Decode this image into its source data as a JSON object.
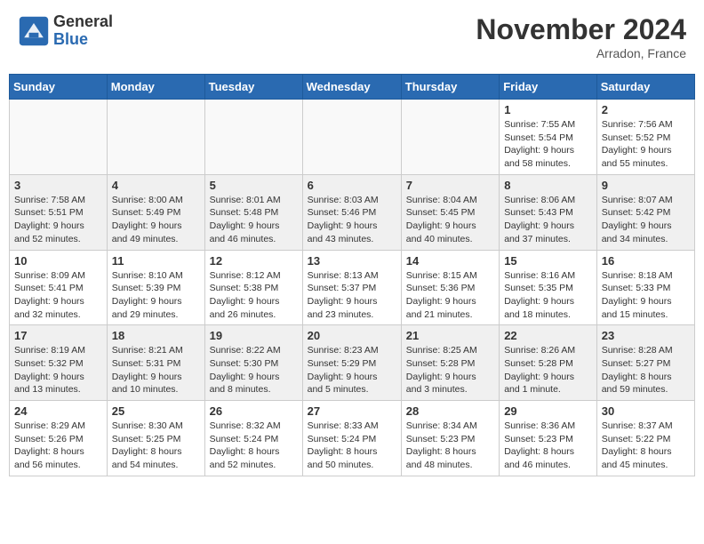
{
  "header": {
    "logo_general": "General",
    "logo_blue": "Blue",
    "month_title": "November 2024",
    "location": "Arradon, France"
  },
  "weekdays": [
    "Sunday",
    "Monday",
    "Tuesday",
    "Wednesday",
    "Thursday",
    "Friday",
    "Saturday"
  ],
  "weeks": [
    [
      {
        "day": "",
        "info": ""
      },
      {
        "day": "",
        "info": ""
      },
      {
        "day": "",
        "info": ""
      },
      {
        "day": "",
        "info": ""
      },
      {
        "day": "",
        "info": ""
      },
      {
        "day": "1",
        "info": "Sunrise: 7:55 AM\nSunset: 5:54 PM\nDaylight: 9 hours\nand 58 minutes."
      },
      {
        "day": "2",
        "info": "Sunrise: 7:56 AM\nSunset: 5:52 PM\nDaylight: 9 hours\nand 55 minutes."
      }
    ],
    [
      {
        "day": "3",
        "info": "Sunrise: 7:58 AM\nSunset: 5:51 PM\nDaylight: 9 hours\nand 52 minutes."
      },
      {
        "day": "4",
        "info": "Sunrise: 8:00 AM\nSunset: 5:49 PM\nDaylight: 9 hours\nand 49 minutes."
      },
      {
        "day": "5",
        "info": "Sunrise: 8:01 AM\nSunset: 5:48 PM\nDaylight: 9 hours\nand 46 minutes."
      },
      {
        "day": "6",
        "info": "Sunrise: 8:03 AM\nSunset: 5:46 PM\nDaylight: 9 hours\nand 43 minutes."
      },
      {
        "day": "7",
        "info": "Sunrise: 8:04 AM\nSunset: 5:45 PM\nDaylight: 9 hours\nand 40 minutes."
      },
      {
        "day": "8",
        "info": "Sunrise: 8:06 AM\nSunset: 5:43 PM\nDaylight: 9 hours\nand 37 minutes."
      },
      {
        "day": "9",
        "info": "Sunrise: 8:07 AM\nSunset: 5:42 PM\nDaylight: 9 hours\nand 34 minutes."
      }
    ],
    [
      {
        "day": "10",
        "info": "Sunrise: 8:09 AM\nSunset: 5:41 PM\nDaylight: 9 hours\nand 32 minutes."
      },
      {
        "day": "11",
        "info": "Sunrise: 8:10 AM\nSunset: 5:39 PM\nDaylight: 9 hours\nand 29 minutes."
      },
      {
        "day": "12",
        "info": "Sunrise: 8:12 AM\nSunset: 5:38 PM\nDaylight: 9 hours\nand 26 minutes."
      },
      {
        "day": "13",
        "info": "Sunrise: 8:13 AM\nSunset: 5:37 PM\nDaylight: 9 hours\nand 23 minutes."
      },
      {
        "day": "14",
        "info": "Sunrise: 8:15 AM\nSunset: 5:36 PM\nDaylight: 9 hours\nand 21 minutes."
      },
      {
        "day": "15",
        "info": "Sunrise: 8:16 AM\nSunset: 5:35 PM\nDaylight: 9 hours\nand 18 minutes."
      },
      {
        "day": "16",
        "info": "Sunrise: 8:18 AM\nSunset: 5:33 PM\nDaylight: 9 hours\nand 15 minutes."
      }
    ],
    [
      {
        "day": "17",
        "info": "Sunrise: 8:19 AM\nSunset: 5:32 PM\nDaylight: 9 hours\nand 13 minutes."
      },
      {
        "day": "18",
        "info": "Sunrise: 8:21 AM\nSunset: 5:31 PM\nDaylight: 9 hours\nand 10 minutes."
      },
      {
        "day": "19",
        "info": "Sunrise: 8:22 AM\nSunset: 5:30 PM\nDaylight: 9 hours\nand 8 minutes."
      },
      {
        "day": "20",
        "info": "Sunrise: 8:23 AM\nSunset: 5:29 PM\nDaylight: 9 hours\nand 5 minutes."
      },
      {
        "day": "21",
        "info": "Sunrise: 8:25 AM\nSunset: 5:28 PM\nDaylight: 9 hours\nand 3 minutes."
      },
      {
        "day": "22",
        "info": "Sunrise: 8:26 AM\nSunset: 5:28 PM\nDaylight: 9 hours\nand 1 minute."
      },
      {
        "day": "23",
        "info": "Sunrise: 8:28 AM\nSunset: 5:27 PM\nDaylight: 8 hours\nand 59 minutes."
      }
    ],
    [
      {
        "day": "24",
        "info": "Sunrise: 8:29 AM\nSunset: 5:26 PM\nDaylight: 8 hours\nand 56 minutes."
      },
      {
        "day": "25",
        "info": "Sunrise: 8:30 AM\nSunset: 5:25 PM\nDaylight: 8 hours\nand 54 minutes."
      },
      {
        "day": "26",
        "info": "Sunrise: 8:32 AM\nSunset: 5:24 PM\nDaylight: 8 hours\nand 52 minutes."
      },
      {
        "day": "27",
        "info": "Sunrise: 8:33 AM\nSunset: 5:24 PM\nDaylight: 8 hours\nand 50 minutes."
      },
      {
        "day": "28",
        "info": "Sunrise: 8:34 AM\nSunset: 5:23 PM\nDaylight: 8 hours\nand 48 minutes."
      },
      {
        "day": "29",
        "info": "Sunrise: 8:36 AM\nSunset: 5:23 PM\nDaylight: 8 hours\nand 46 minutes."
      },
      {
        "day": "30",
        "info": "Sunrise: 8:37 AM\nSunset: 5:22 PM\nDaylight: 8 hours\nand 45 minutes."
      }
    ]
  ]
}
